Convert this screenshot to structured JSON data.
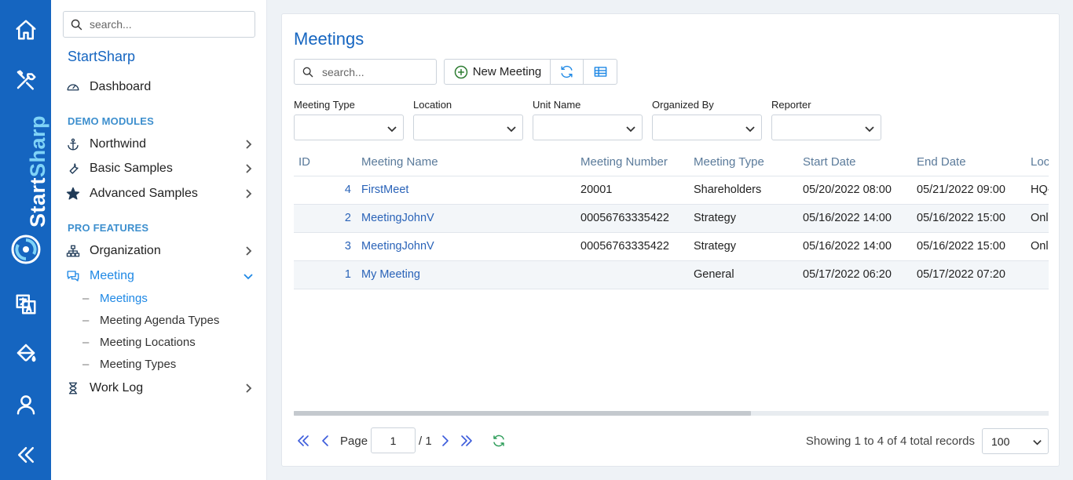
{
  "rail": {
    "brand_part1": "Start",
    "brand_part2": "Sharp",
    "icons": [
      "home-icon",
      "tools-icon",
      "translate-icon",
      "paint-bucket-icon",
      "user-icon",
      "collapse-icon"
    ]
  },
  "sidebar": {
    "search_placeholder": "search...",
    "app_title": "StartSharp",
    "dashboard": "Dashboard",
    "section_demo": "DEMO MODULES",
    "northwind": "Northwind",
    "basic_samples": "Basic Samples",
    "advanced_samples": "Advanced Samples",
    "section_pro": "PRO FEATURES",
    "organization": "Organization",
    "meeting": "Meeting",
    "sub_items": [
      "Meetings",
      "Meeting Agenda Types",
      "Meeting Locations",
      "Meeting Types"
    ],
    "work_log": "Work Log"
  },
  "main": {
    "title": "Meetings",
    "search_placeholder": "search...",
    "new_button": "New Meeting",
    "filters": [
      "Meeting Type",
      "Location",
      "Unit Name",
      "Organized By",
      "Reporter"
    ],
    "columns": [
      "ID",
      "Meeting Name",
      "Meeting Number",
      "Meeting Type",
      "Start Date",
      "End Date",
      "Location"
    ],
    "rows": [
      {
        "id": "4",
        "name": "FirstMeet",
        "number": "20001",
        "type": "Shareholders",
        "start": "05/20/2022 08:00",
        "end": "05/21/2022 09:00",
        "location": "HQ-Main"
      },
      {
        "id": "2",
        "name": "MeetingJohnV",
        "number": "00056763335422",
        "type": "Strategy",
        "start": "05/16/2022 14:00",
        "end": "05/16/2022 15:00",
        "location": "Online"
      },
      {
        "id": "3",
        "name": "MeetingJohnV",
        "number": "00056763335422",
        "type": "Strategy",
        "start": "05/16/2022 14:00",
        "end": "05/16/2022 15:00",
        "location": "Online"
      },
      {
        "id": "1",
        "name": "My Meeting",
        "number": "",
        "type": "General",
        "start": "05/17/2022 06:20",
        "end": "05/17/2022 07:20",
        "location": ""
      }
    ]
  },
  "pager": {
    "page_label": "Page",
    "page_value": "1",
    "of_label": "/ 1",
    "info": "Showing 1 to 4 of 4 total records",
    "page_size": "100"
  },
  "colors": {
    "rail": "#1565c0",
    "accent": "#1e88e5",
    "title": "#1565c0"
  }
}
